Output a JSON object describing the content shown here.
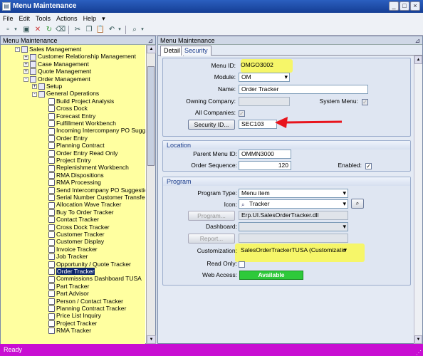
{
  "window": {
    "title": "Menu Maintenance"
  },
  "menu": [
    "File",
    "Edit",
    "Tools",
    "Actions",
    "Help"
  ],
  "left_header": "Menu Maintenance",
  "right_header": "Menu Maintenance",
  "tree": [
    {
      "label": "Sales Management",
      "depth": 0,
      "type": "folder",
      "expander": "-"
    },
    {
      "label": "Customer Relationship Management",
      "depth": 1,
      "type": "folder",
      "expander": "+"
    },
    {
      "label": "Case Management",
      "depth": 1,
      "type": "folder",
      "expander": "+"
    },
    {
      "label": "Quote Management",
      "depth": 1,
      "type": "folder",
      "expander": "+"
    },
    {
      "label": "Order Management",
      "depth": 1,
      "type": "folder",
      "expander": "-"
    },
    {
      "label": "Setup",
      "depth": 2,
      "type": "folder",
      "expander": "+"
    },
    {
      "label": "General Operations",
      "depth": 2,
      "type": "folder",
      "expander": "-"
    },
    {
      "label": "Build Project Analysis",
      "depth": 3,
      "type": "doc"
    },
    {
      "label": "Cross Dock",
      "depth": 3,
      "type": "doc"
    },
    {
      "label": "Forecast Entry",
      "depth": 3,
      "type": "doc"
    },
    {
      "label": "Fulfillment Workbench",
      "depth": 3,
      "type": "doc"
    },
    {
      "label": "Incoming Intercompany PO Sugge",
      "depth": 3,
      "type": "doc"
    },
    {
      "label": "Order Entry",
      "depth": 3,
      "type": "doc"
    },
    {
      "label": "Planning Contract",
      "depth": 3,
      "type": "doc"
    },
    {
      "label": "Order Entry Read Only",
      "depth": 3,
      "type": "doc"
    },
    {
      "label": "Project Entry",
      "depth": 3,
      "type": "doc"
    },
    {
      "label": "Replenishment Workbench",
      "depth": 3,
      "type": "doc"
    },
    {
      "label": "RMA Dispositions",
      "depth": 3,
      "type": "doc"
    },
    {
      "label": "RMA Processing",
      "depth": 3,
      "type": "doc"
    },
    {
      "label": "Send Intercompany PO Suggestio",
      "depth": 3,
      "type": "doc"
    },
    {
      "label": "Serial Number Customer Transfer",
      "depth": 3,
      "type": "doc"
    },
    {
      "label": "Allocation Wave Tracker",
      "depth": 3,
      "type": "doc"
    },
    {
      "label": "Buy To Order Tracker",
      "depth": 3,
      "type": "doc"
    },
    {
      "label": "Contact Tracker",
      "depth": 3,
      "type": "doc"
    },
    {
      "label": "Cross Dock Tracker",
      "depth": 3,
      "type": "doc"
    },
    {
      "label": "Customer Tracker",
      "depth": 3,
      "type": "doc"
    },
    {
      "label": "Customer Display",
      "depth": 3,
      "type": "doc"
    },
    {
      "label": "Invoice Tracker",
      "depth": 3,
      "type": "doc"
    },
    {
      "label": "Job Tracker",
      "depth": 3,
      "type": "doc"
    },
    {
      "label": "Opportunity / Quote Tracker",
      "depth": 3,
      "type": "doc"
    },
    {
      "label": "Order Tracker",
      "depth": 3,
      "type": "doc",
      "selected": true
    },
    {
      "label": "Commissions Dashboard TUSA",
      "depth": 3,
      "type": "doc"
    },
    {
      "label": "Part Tracker",
      "depth": 3,
      "type": "doc"
    },
    {
      "label": "Part Advisor",
      "depth": 3,
      "type": "doc"
    },
    {
      "label": "Person / Contact Tracker",
      "depth": 3,
      "type": "doc"
    },
    {
      "label": "Planning Contract Tracker",
      "depth": 3,
      "type": "doc"
    },
    {
      "label": "Price List Inquiry",
      "depth": 3,
      "type": "doc"
    },
    {
      "label": "Project Tracker",
      "depth": 3,
      "type": "doc"
    },
    {
      "label": "RMA Tracker",
      "depth": 3,
      "type": "doc"
    }
  ],
  "tabs": [
    "Detail",
    "Security"
  ],
  "detail": {
    "menu_id_label": "Menu ID:",
    "menu_id": "OMGO3002",
    "module_label": "Module:",
    "module": "OM",
    "name_label": "Name:",
    "name": "Order Tracker",
    "owning_company_label": "Owning Company:",
    "owning_company": "",
    "system_menu_label": "System Menu:",
    "system_menu": "✓",
    "all_companies_label": "All Companies:",
    "all_companies": "✓",
    "security_button": "Security ID...",
    "security_id": "SEC103"
  },
  "location": {
    "title": "Location",
    "parent_label": "Parent Menu ID:",
    "parent": "OMMN3000",
    "sequence_label": "Order Sequence:",
    "sequence": "120",
    "enabled_label": "Enabled:",
    "enabled": "✓"
  },
  "program": {
    "title": "Program",
    "type_label": "Program Type:",
    "type": "Menu item",
    "icon_label": "Icon:",
    "icon": "Tracker",
    "program_button": "Program...",
    "program": "Erp.UI.SalesOrderTracker.dll",
    "dashboard_label": "Dashboard:",
    "dashboard": "",
    "report_button": "Report...",
    "report": "",
    "customization_label": "Customization:",
    "customization": "SalesOrderTrackerTUSA (Customizatio",
    "readonly_label": "Read Only:",
    "webaccess_label": "Web Access:",
    "webaccess": "Available"
  },
  "status": "Ready",
  "colors": {
    "highlight": "#f6f669",
    "arrow": "#e8141c",
    "statusbar": "#c80ed2",
    "available": "#2ec93a"
  }
}
